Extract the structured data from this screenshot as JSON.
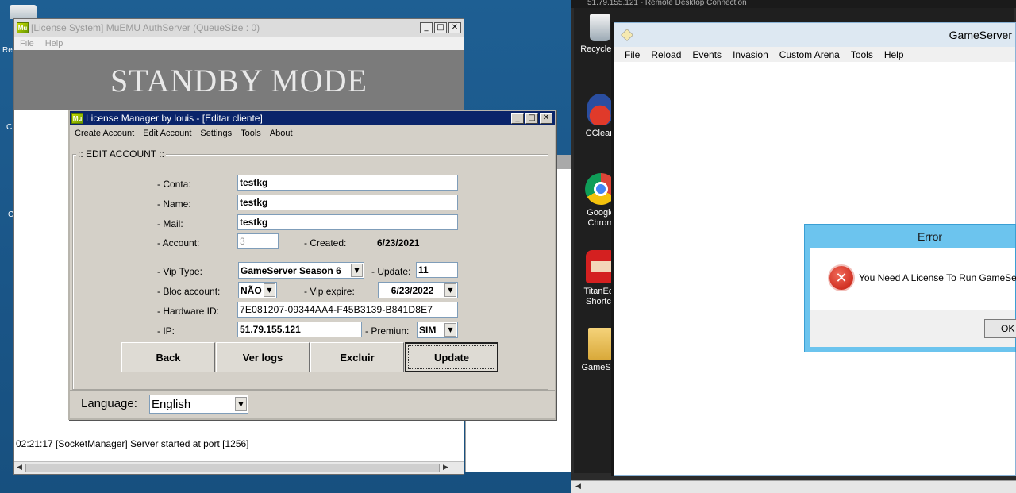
{
  "auth_window": {
    "logo": "Mu",
    "title": "[License System] MuEMU AuthServer (QueueSize : 0)",
    "menu": [
      "File",
      "Help"
    ],
    "standby_text": "STANDBY MODE",
    "log_line": "02:21:17 [SocketManager] Server started at port [1256]"
  },
  "license_manager": {
    "logo": "Mu",
    "title": "License Manager by louis - [Editar cliente]",
    "menu": [
      "Create Account",
      "Edit Account",
      "Settings",
      "Tools",
      "About"
    ],
    "group_title": ":: EDIT ACCOUNT ::",
    "fields": {
      "conta": {
        "label": "- Conta:",
        "value": "testkg"
      },
      "name": {
        "label": "- Name:",
        "value": "testkg"
      },
      "mail": {
        "label": "- Mail:",
        "value": "testkg"
      },
      "account": {
        "label": "- Account:",
        "value": "3"
      },
      "created": {
        "label": "- Created:",
        "value": "6/23/2021"
      },
      "vip_type": {
        "label": "- Vip Type:",
        "value": "GameServer Season 6"
      },
      "update": {
        "label": "- Update:",
        "value": "11"
      },
      "bloc_account": {
        "label": "- Bloc account:",
        "value": "NÃO"
      },
      "vip_expire": {
        "label": "- Vip expire:",
        "value": "6/23/2022"
      },
      "hardware_id": {
        "label": "- Hardware ID:",
        "value": "7E081207-09344AA4-F45B3139-B841D8E7"
      },
      "ip": {
        "label": "- IP:",
        "value": "51.79.155.121"
      },
      "premium": {
        "label": "- Premiun:",
        "value": "SIM"
      }
    },
    "buttons": {
      "back": "Back",
      "ver_logs": "Ver logs",
      "excluir": "Excluir",
      "update": "Update"
    },
    "language_label": "Language:",
    "language_value": "English"
  },
  "rdp": {
    "title": "51.79.155.121 - Remote Desktop Connection",
    "desktop_icons": [
      {
        "label": "Recycle B",
        "icon": "recycle-bin-icon"
      },
      {
        "label": "CClean",
        "icon": "ccleaner-icon"
      },
      {
        "label": "Google Chrom",
        "icon": "chrome-icon"
      },
      {
        "label": "TitanEdit Shortcu",
        "icon": "titan-editor-icon"
      },
      {
        "label": "GameSer",
        "icon": "folder-icon"
      }
    ],
    "gameserver": {
      "title": "GameServer",
      "menu": [
        "File",
        "Reload",
        "Events",
        "Invasion",
        "Custom Arena",
        "Tools",
        "Help"
      ]
    },
    "error_dialog": {
      "title": "Error",
      "message": "You Need A License To Run GameServe",
      "ok": "OK"
    }
  },
  "left_desktop_stubs": [
    "Re",
    "C",
    "C"
  ]
}
